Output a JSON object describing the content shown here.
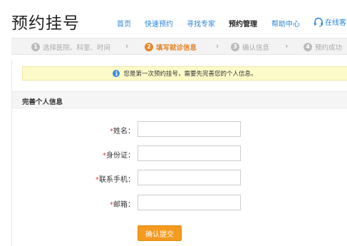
{
  "header": {
    "logo": "预约挂号",
    "nav": [
      {
        "label": "首页"
      },
      {
        "label": "快速预约"
      },
      {
        "label": "寻找专家"
      },
      {
        "label": "预约管理"
      },
      {
        "label": "帮助中心"
      }
    ],
    "service_label": "在线客"
  },
  "steps": [
    {
      "num": "1",
      "label": "选择医院、科室、时间"
    },
    {
      "num": "2",
      "label": "填写就诊信息"
    },
    {
      "num": "3",
      "label": "确认信息"
    },
    {
      "num": "4",
      "label": "预约成功"
    }
  ],
  "notice": {
    "text": "您是第一次预约挂号，需要先完善您的个人信息。"
  },
  "section": {
    "title": "完善个人信息"
  },
  "form": {
    "required_mark": "*",
    "fields": [
      {
        "label": "姓名：",
        "value": ""
      },
      {
        "label": "身份证：",
        "value": ""
      },
      {
        "label": "联系手机：",
        "value": ""
      },
      {
        "label": "邮箱：",
        "value": ""
      }
    ],
    "submit_label": "确认提交"
  },
  "colors": {
    "accent": "#f39a1f",
    "link": "#2a86d6",
    "active_step": "#e5862a",
    "notice_bg": "#fdfbc9",
    "required": "#e23c2c"
  }
}
